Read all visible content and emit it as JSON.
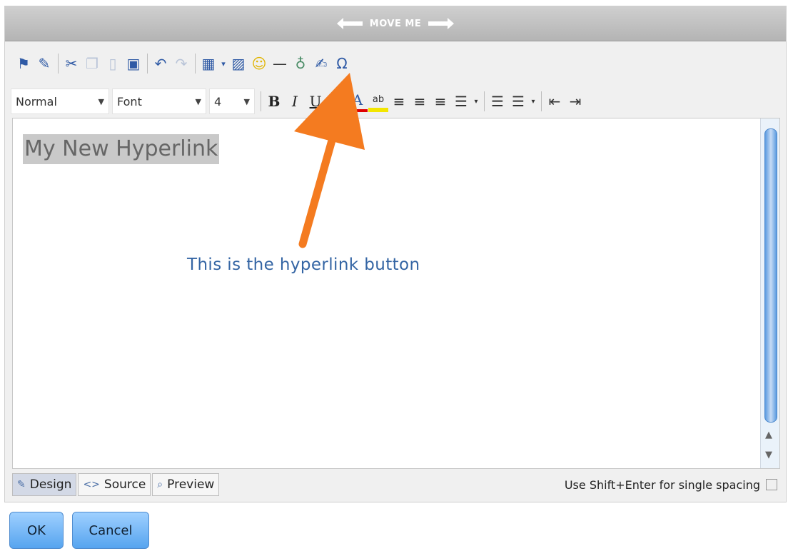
{
  "window": {
    "title": "MOVE ME"
  },
  "toolbar": {
    "icons": [
      "find-icon",
      "spellcheck-icon",
      "cut-icon",
      "copy-icon",
      "paste-icon",
      "paste-word-icon",
      "undo-icon",
      "redo-icon",
      "table-icon",
      "image-icon",
      "smiley-icon",
      "horizontal-rule-icon",
      "hyperlink-icon",
      "format-painter-icon",
      "special-character-icon"
    ],
    "paragraph_format": "Normal",
    "font": "Font",
    "size": "4",
    "bold": "B",
    "italic": "I",
    "underline": "U",
    "font_color": "A",
    "highlight": "ab",
    "omega": "Ω"
  },
  "editor": {
    "content": "My New Hyperlink",
    "annotation": "This is the hyperlink button"
  },
  "tabs": {
    "design": "Design",
    "source": "Source",
    "preview": "Preview"
  },
  "hint": "Use Shift+Enter for single spacing",
  "buttons": {
    "ok": "OK",
    "cancel": "Cancel"
  },
  "colors": {
    "accent": "#f47b20",
    "link_blue": "#3465a4",
    "button_blue": "#56a4ef"
  }
}
